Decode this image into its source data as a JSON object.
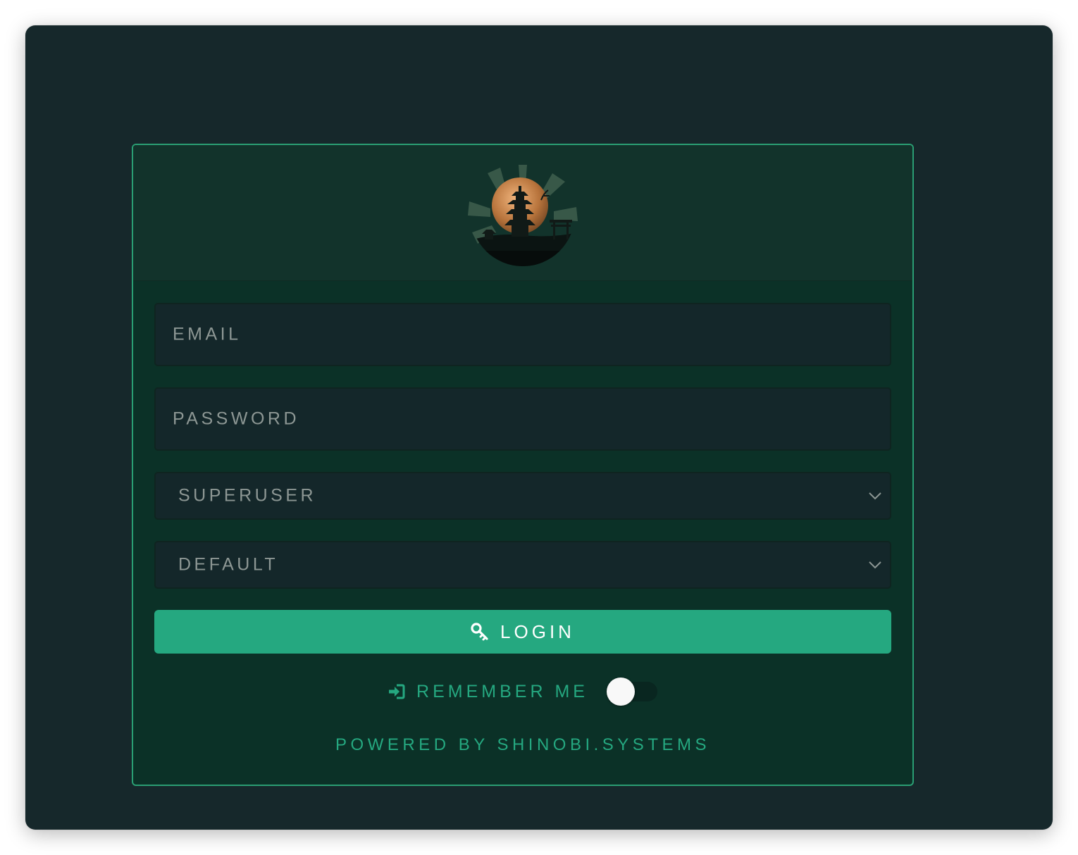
{
  "form": {
    "email_placeholder": "EMAIL",
    "password_placeholder": "PASSWORD",
    "role_select_value": "SUPERUSER",
    "group_select_value": "DEFAULT",
    "login_label": "LOGIN",
    "login_icon": "key-icon",
    "remember_label": "REMEMBER ME",
    "remember_icon": "sign-in-icon",
    "remember_on": false
  },
  "footer": {
    "powered_by": "POWERED BY SHINOBI.SYSTEMS"
  },
  "logo": {
    "icon": "shinobi-pagoda-logo"
  },
  "colors": {
    "background": "#16282b",
    "card": "#0b3127",
    "card_header": "#12332b",
    "border_accent": "#2a9e73",
    "accent": "#25a880",
    "field_bg": "#14272a",
    "field_text": "#8d9794"
  }
}
